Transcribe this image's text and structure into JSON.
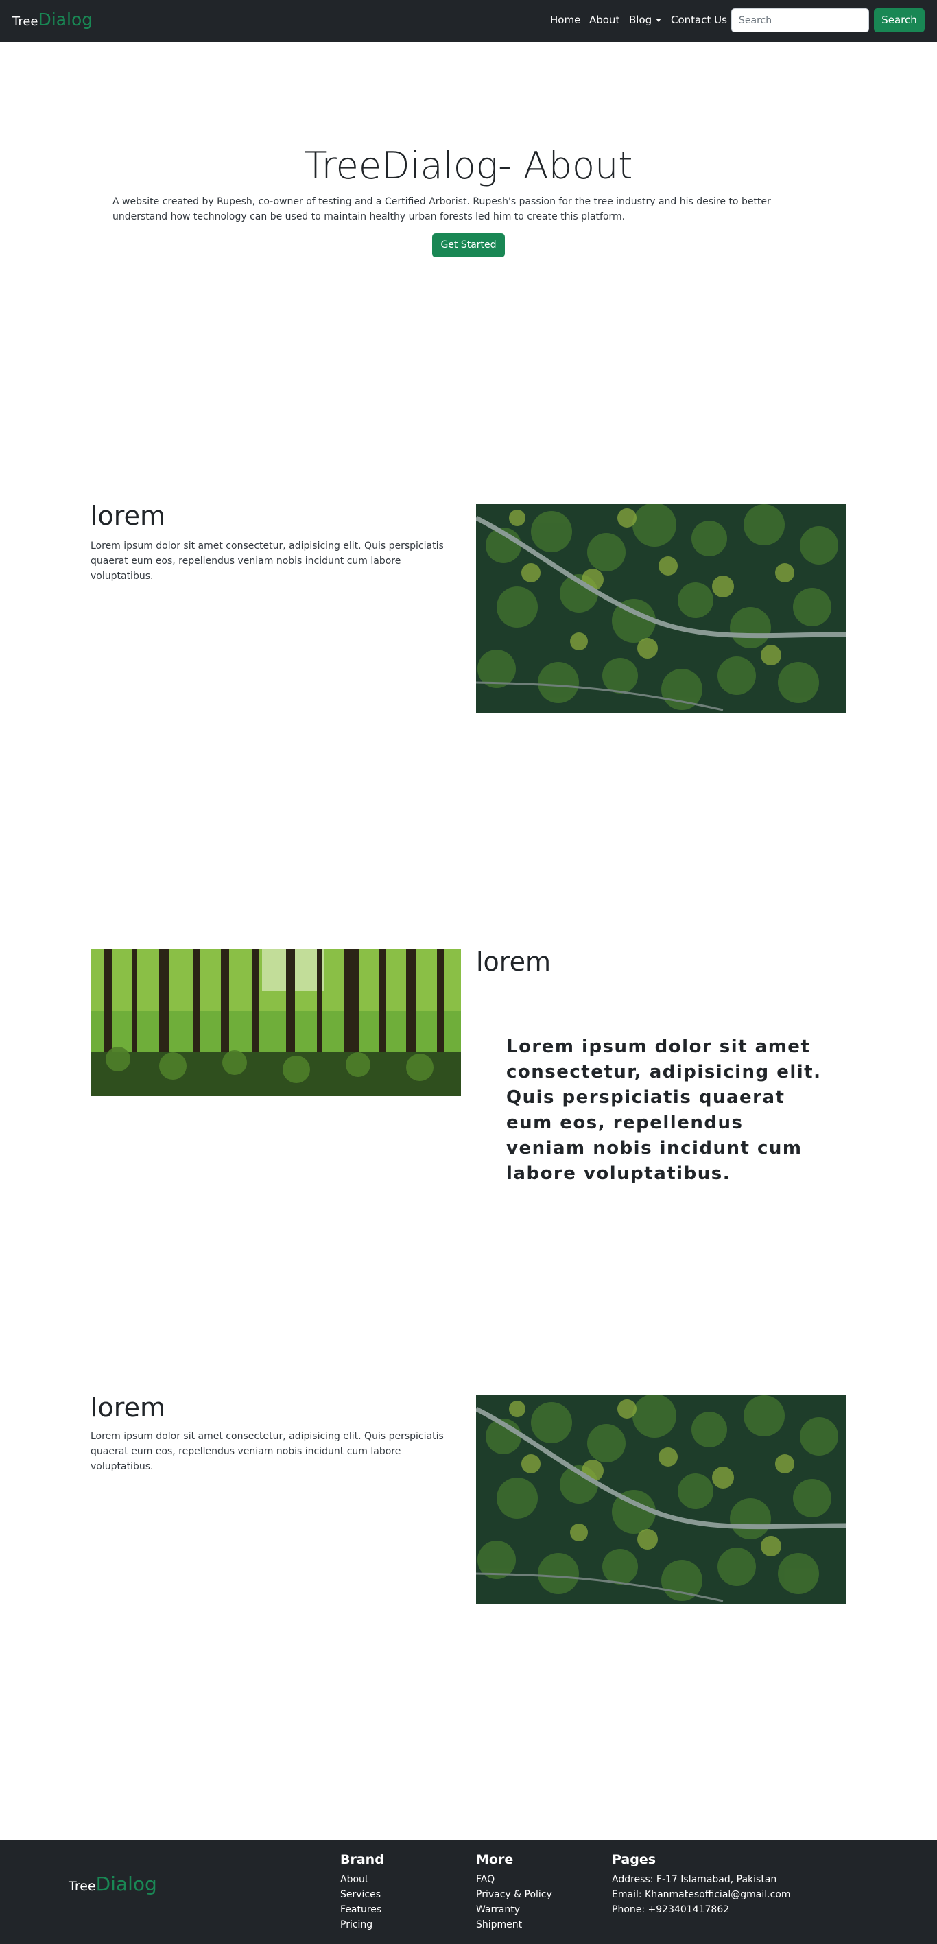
{
  "navbar": {
    "brand_part1": "Tree",
    "brand_part2": "Dialog",
    "links": [
      "Home",
      "About",
      "Blog",
      "Contact Us"
    ],
    "search_placeholder": "Search",
    "search_button": "Search"
  },
  "hero": {
    "title": "TreeDialog- About",
    "description": "A website created by Rupesh, co-owner of testing and a Certified Arborist. Rupesh's passion for the tree industry and his desire to better understand how technology can be used to maintain healthy urban forests led him to create this platform.",
    "button": "Get Started"
  },
  "sections": [
    {
      "heading": "lorem",
      "text": "Lorem ipsum dolor sit amet consectetur, adipisicing elit. Quis perspiciatis quaerat eum eos, repellendus veniam nobis incidunt cum labore voluptatibus.",
      "image": "aerial-forest-road"
    },
    {
      "heading": "lorem",
      "text": "Lorem ipsum dolor sit amet consectetur, adipisicing elit. Quis perspiciatis quaerat eum eos, repellendus veniam nobis incidunt cum labore voluptatibus.",
      "image": "forest-trunks"
    },
    {
      "heading": "lorem",
      "text": "Lorem ipsum dolor sit amet consectetur, adipisicing elit. Quis perspiciatis quaerat eum eos, repellendus veniam nobis incidunt cum labore voluptatibus.",
      "image": "aerial-forest-road"
    }
  ],
  "footer": {
    "brand_part1": "Tree",
    "brand_part2": "Dialog",
    "columns": [
      {
        "heading": "Brand",
        "items": [
          "About",
          "Services",
          "Features",
          "Pricing"
        ]
      },
      {
        "heading": "More",
        "items": [
          "FAQ",
          "Privacy & Policy",
          "Warranty",
          "Shipment"
        ]
      },
      {
        "heading": "Pages",
        "items": [
          "Address: F-17 Islamabad, Pakistan",
          "Email: Khanmatesofficial@gmail.com",
          "Phone: +923401417862"
        ]
      }
    ]
  },
  "colors": {
    "navbar_bg": "#212529",
    "accent_green": "#198754",
    "footer_bg": "#212529"
  }
}
